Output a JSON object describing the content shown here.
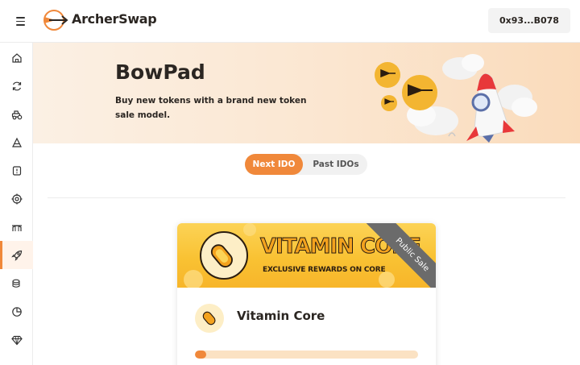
{
  "header": {
    "brand": "ArcherSwap",
    "wallet_address": "0x93...B078"
  },
  "sidebar": {
    "items": [
      {
        "icon": "home-icon"
      },
      {
        "icon": "swap-icon"
      },
      {
        "icon": "farm-icon"
      },
      {
        "icon": "pools-icon"
      },
      {
        "icon": "lottery-icon"
      },
      {
        "icon": "target-icon"
      },
      {
        "icon": "bridge-icon"
      },
      {
        "icon": "rocket-icon",
        "active": true
      },
      {
        "icon": "coins-icon"
      },
      {
        "icon": "chart-pie-icon"
      },
      {
        "icon": "diamond-icon"
      }
    ]
  },
  "hero": {
    "title": "BowPad",
    "subtitle": "Buy new tokens with a brand new token sale model."
  },
  "tabs": {
    "next": "Next IDO",
    "past": "Past IDOs",
    "active": "next"
  },
  "card": {
    "banner_title": "VITAMIN CORE",
    "banner_subtitle": "EXCLUSIVE REWARDS ON CORE",
    "ribbon": "Public Sale",
    "name": "Vitamin Core",
    "progress_fraction": 0.05
  },
  "colors": {
    "accent": "#f0883a",
    "banner_yellow": "#f9c233",
    "hero_bg": "#fbe7d2"
  }
}
